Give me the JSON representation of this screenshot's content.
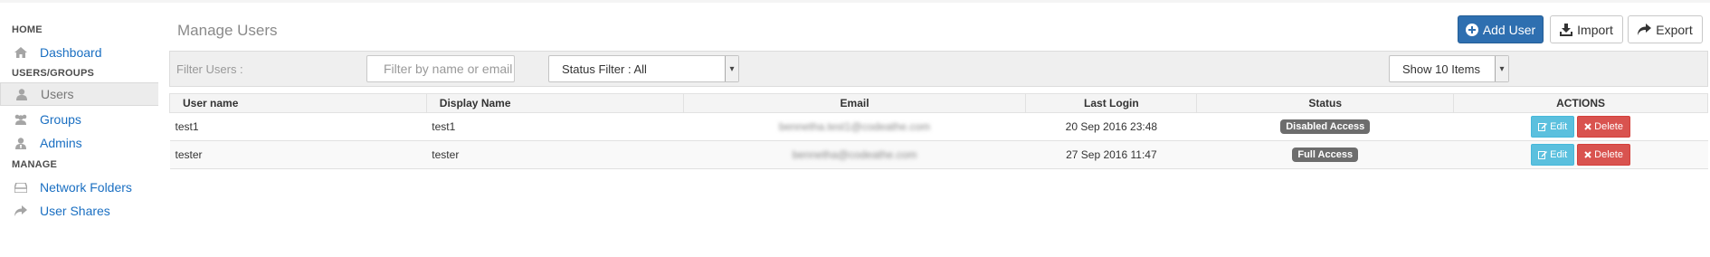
{
  "sidebar": {
    "sections": [
      {
        "heading": "HOME",
        "items": [
          {
            "label": "Dashboard",
            "icon": "home-icon",
            "active": false
          }
        ]
      },
      {
        "heading": "USERS/GROUPS",
        "items": [
          {
            "label": "Users",
            "icon": "user-icon",
            "active": true
          },
          {
            "label": "Groups",
            "icon": "group-icon",
            "active": false
          },
          {
            "label": "Admins",
            "icon": "admin-icon",
            "active": false
          }
        ]
      },
      {
        "heading": "MANAGE",
        "items": [
          {
            "label": "Network Folders",
            "icon": "network-folder-icon",
            "active": false
          },
          {
            "label": "User Shares",
            "icon": "share-icon",
            "active": false
          }
        ]
      }
    ]
  },
  "main": {
    "title": "Manage Users",
    "toolbar": {
      "add_label": "Add User",
      "import_label": "Import",
      "export_label": "Export"
    },
    "filter": {
      "label": "Filter Users :",
      "placeholder": "Filter by name or email",
      "value": "",
      "status_select": "Status Filter : All",
      "page_size_select": "Show 10 Items"
    },
    "table": {
      "columns": [
        "User name",
        "Display Name",
        "Email",
        "Last Login",
        "Status",
        "ACTIONS"
      ],
      "rows": [
        {
          "username": "test1",
          "display": "test1",
          "email": "bennetha.test1@codeathe.com",
          "last_login": "20 Sep 2016 23:48",
          "status": "Disabled Access"
        },
        {
          "username": "tester",
          "display": "tester",
          "email": "bennetha@codeathe.com",
          "last_login": "27 Sep 2016 11:47",
          "status": "Full Access"
        }
      ],
      "edit_label": "Edit",
      "delete_label": "Delete"
    }
  },
  "colors": {
    "primary": "#2e6fb0",
    "link": "#1a6fc2",
    "edit": "#5bc0de",
    "delete": "#d9534f",
    "badge": "#6d6d6d"
  }
}
